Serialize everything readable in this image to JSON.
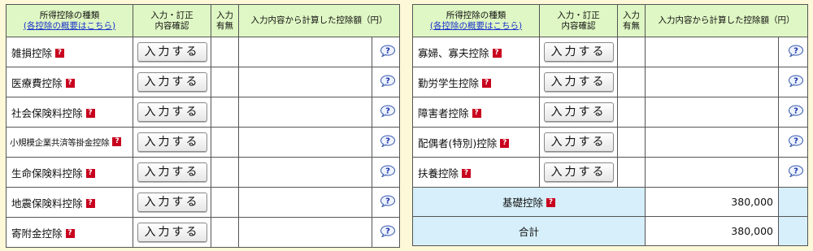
{
  "header": {
    "col_type_title": "所得控除の種類",
    "col_type_link": "(各控除の概要はこちら)",
    "col_input_line1": "入力・訂正",
    "col_input_line2": "内容確認",
    "col_status_line1": "入力",
    "col_status_line2": "有無",
    "col_amount": "入力内容から計算した控除額（円）"
  },
  "button_label": "入力する",
  "help_icon": "question-bubble-icon",
  "left_rows": [
    {
      "name": "雑損控除"
    },
    {
      "name": "医療費控除"
    },
    {
      "name": "社会保険料控除"
    },
    {
      "name": "小規模企業共済等掛金控除"
    },
    {
      "name": "生命保険料控除"
    },
    {
      "name": "地震保険料控除"
    },
    {
      "name": "寄附金控除"
    }
  ],
  "right_rows": [
    {
      "name": "寡婦、寡夫控除"
    },
    {
      "name": "勤労学生控除"
    },
    {
      "name": "障害者控除"
    },
    {
      "name": "配偶者(特別)控除"
    },
    {
      "name": "扶養控除"
    }
  ],
  "basic_deduction": {
    "label": "基礎控除",
    "value": "380,000"
  },
  "total": {
    "label": "合計",
    "value": "380,000"
  },
  "colors": {
    "header_bg": "#dff7c4",
    "summary_bg": "#d6effa",
    "page_bg": "#fdf8d8",
    "help_icon_red": "#c8001e"
  }
}
